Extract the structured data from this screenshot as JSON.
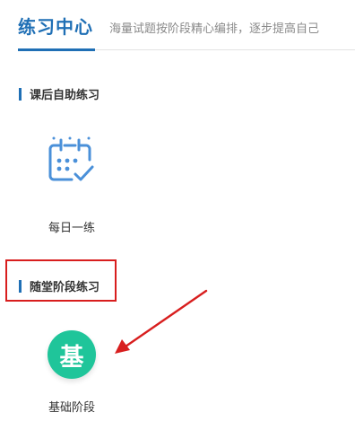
{
  "header": {
    "title": "练习中心",
    "subtitle": "海量试题按阶段精心编排，逐步提高自己"
  },
  "sections": [
    {
      "heading": "课后自助练习",
      "items": [
        {
          "label": "每日一练",
          "icon": "calendar-check-icon"
        }
      ]
    },
    {
      "heading": "随堂阶段练习",
      "items": [
        {
          "label": "基础阶段",
          "icon_glyph": "基",
          "icon": "foundation-badge-icon"
        }
      ]
    }
  ],
  "colors": {
    "accent": "#1f6fb5",
    "annotation": "#d81e1e",
    "badge": "#1fc59a",
    "calendar_icon": "#4a90d9"
  }
}
